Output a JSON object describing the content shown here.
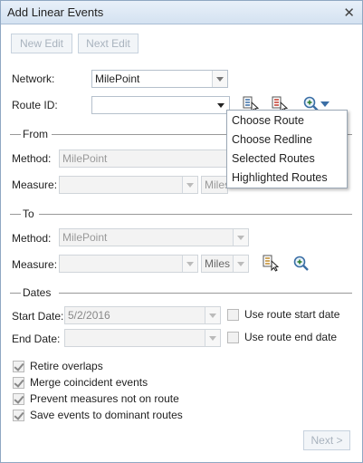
{
  "window": {
    "title": "Add Linear Events"
  },
  "toolbar": {
    "new_edit_label": "New Edit",
    "next_edit_label": "Next Edit"
  },
  "network": {
    "label": "Network:",
    "value": "MilePoint"
  },
  "route": {
    "label": "Route ID:",
    "value": ""
  },
  "route_menu": {
    "items": [
      {
        "label": "Choose Route"
      },
      {
        "label": "Choose Redline"
      },
      {
        "label": "Selected Routes"
      },
      {
        "label": "Highlighted Routes"
      }
    ]
  },
  "from": {
    "title": "From",
    "method_label": "Method:",
    "method_value": "MilePoint",
    "measure_label": "Measure:",
    "measure_value": "",
    "units_value": "Miles"
  },
  "to": {
    "title": "To",
    "method_label": "Method:",
    "method_value": "MilePoint",
    "measure_label": "Measure:",
    "measure_value": "",
    "units_value": "Miles"
  },
  "dates": {
    "title": "Dates",
    "start_label": "Start Date:",
    "start_value": "5/2/2016",
    "use_start_label": "Use route start date",
    "end_label": "End Date:",
    "end_value": "",
    "use_end_label": "Use route end date"
  },
  "options": [
    {
      "label": "Retire overlaps",
      "checked": true
    },
    {
      "label": "Merge coincident events",
      "checked": true
    },
    {
      "label": "Prevent measures not on route",
      "checked": true
    },
    {
      "label": "Save events to dominant routes",
      "checked": true
    }
  ],
  "footer": {
    "next_label": "Next >"
  },
  "colors": {
    "titlebar": "#d4e2f1",
    "accent": "#3a6ea5",
    "disabled_text": "#a9b3be"
  }
}
